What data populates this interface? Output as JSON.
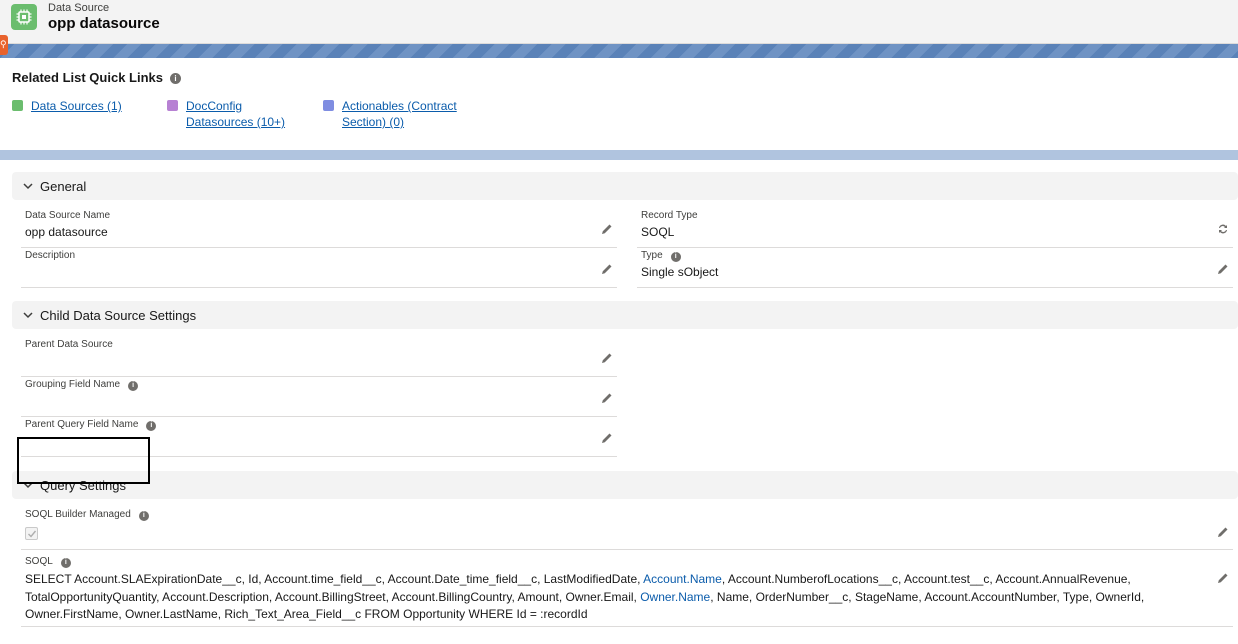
{
  "header": {
    "object_label": "Data Source",
    "record_title": "opp datasource"
  },
  "quick_links": {
    "title": "Related List Quick Links",
    "items": [
      {
        "line1": "Data Sources (1)",
        "line2": "",
        "icon_color": "#6bbd6e",
        "icon": "data-source-icon"
      },
      {
        "line1": "DocConfig",
        "line2": "Datasources (10+)",
        "icon_color": "#b781d3",
        "icon": "docconfig-icon"
      },
      {
        "line1": "Actionables (Contract",
        "line2": "Section) (0)",
        "icon_color": "#7f8de1",
        "icon": "wrench-icon"
      }
    ]
  },
  "sections": {
    "general": {
      "title": "General",
      "fields": {
        "data_source_name": {
          "label": "Data Source Name",
          "value": "opp datasource"
        },
        "record_type": {
          "label": "Record Type",
          "value": "SOQL"
        },
        "description": {
          "label": "Description",
          "value": ""
        },
        "type": {
          "label": "Type",
          "value": "Single sObject"
        }
      }
    },
    "child": {
      "title": "Child Data Source Settings",
      "fields": {
        "parent_data_source": {
          "label": "Parent Data Source",
          "value": ""
        },
        "grouping_field_name": {
          "label": "Grouping Field Name",
          "value": ""
        },
        "parent_query_field_name": {
          "label": "Parent Query Field Name",
          "value": ""
        }
      }
    },
    "query": {
      "title": "Query Settings",
      "fields": {
        "soql_builder_managed": {
          "label": "SOQL Builder Managed",
          "checked": true
        },
        "soql": {
          "label": "SOQL",
          "part1": "SELECT Account.SLAExpirationDate__c, Id, Account.time_field__c, Account.Date_time_field__c, LastModifiedDate, ",
          "link1": "Account.Name",
          "part2": ", Account.NumberofLocations__c, Account.test__c, Account.AnnualRevenue, TotalOpportunityQuantity, Account.Description, Account.BillingStreet, Account.BillingCountry, Amount, Owner.Email, ",
          "link2": "Owner.Name",
          "part3": ", Name, OrderNumber__c, StageName, Account.AccountNumber, Type, OwnerId, Owner.FirstName, Owner.LastName, Rich_Text_Area_Field__c FROM Opportunity WHERE Id = :recordId"
        }
      }
    }
  },
  "colors": {
    "accent": "#0b5cab",
    "banner": "#5a82b8",
    "object_icon": "#6bbd6e"
  }
}
